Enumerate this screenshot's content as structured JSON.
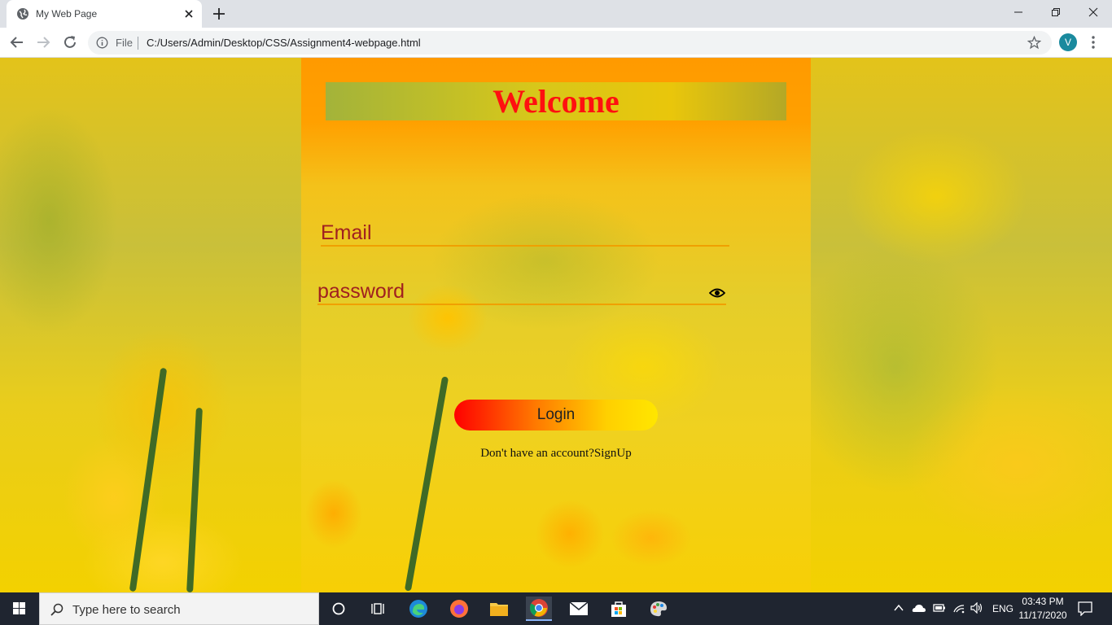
{
  "browser": {
    "tab_title": "My Web Page",
    "address_scheme_label": "File",
    "url": "C:/Users/Admin/Desktop/CSS/Assignment4-webpage.html",
    "profile_initial": "V"
  },
  "page": {
    "welcome_title": "Welcome",
    "email_placeholder": "Email",
    "password_placeholder": "password",
    "login_label": "Login",
    "signup_text": "Don't have an account?SignUp"
  },
  "taskbar": {
    "search_placeholder": "Type here to search",
    "language": "ENG",
    "time": "03:43 PM",
    "date": "11/17/2020"
  }
}
